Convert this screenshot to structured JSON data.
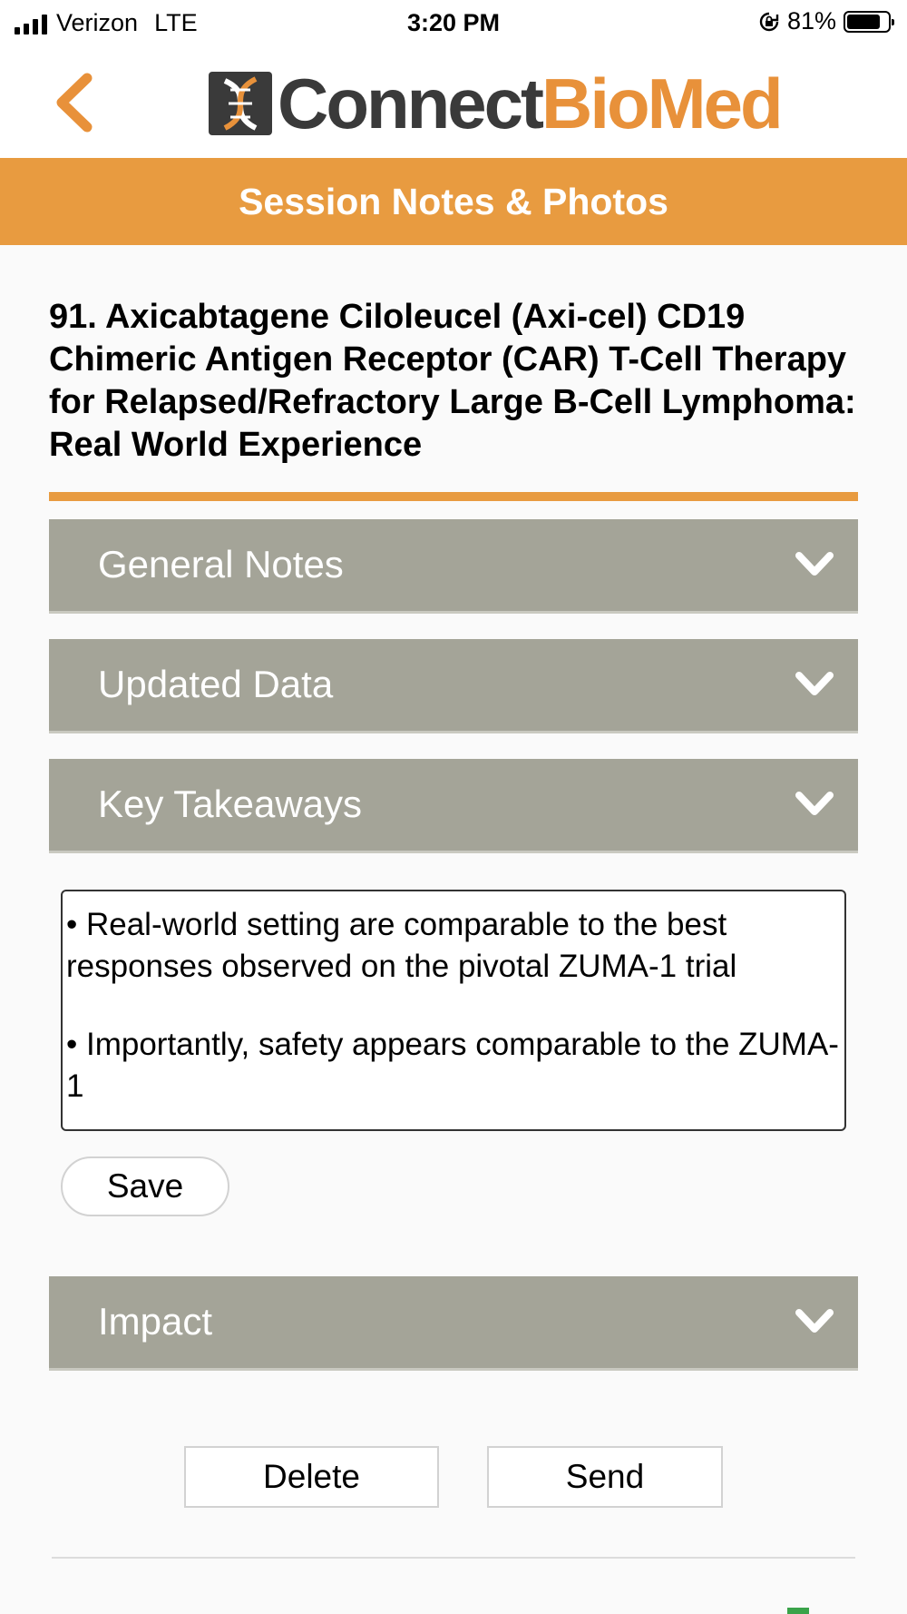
{
  "status_bar": {
    "carrier": "Verizon",
    "network": "LTE",
    "time": "3:20 PM",
    "battery": "81%",
    "battery_level": 0.81
  },
  "header": {
    "back_icon": "chevron-left-icon",
    "logo_left": "Connect",
    "logo_right": "BioMed",
    "logo_icon": "dna-icon"
  },
  "banner": {
    "title": "Session Notes & Photos"
  },
  "session": {
    "title": "91. Axicabtagene Ciloleucel (Axi-cel) CD19 Chimeric Antigen Receptor (CAR) T-Cell Therapy for Relapsed/Refractory Large B-Cell Lymphoma: Real World Experience"
  },
  "sections": [
    {
      "label": "General Notes",
      "icon": "chevron-down-icon"
    },
    {
      "label": "Updated Data",
      "icon": "chevron-down-icon"
    },
    {
      "label": "Key Takeaways",
      "icon": "chevron-down-icon"
    },
    {
      "label": "Impact",
      "icon": "chevron-down-icon"
    }
  ],
  "key_takeaways": {
    "line1": "• Real-world setting are comparable to the best responses observed on the pivotal ZUMA-1 trial",
    "line2": "• Importantly, safety appears comparable to the ZUMA-1",
    "save_label": "Save"
  },
  "actions": {
    "delete_label": "Delete",
    "send_label": "Send"
  },
  "colors": {
    "accent": "#e89b40",
    "accordion": "#a4a498",
    "logo_dark": "#3a3a3a"
  }
}
